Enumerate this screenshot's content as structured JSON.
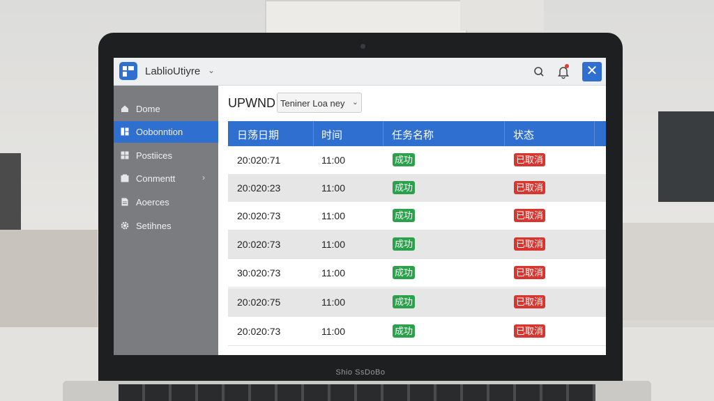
{
  "app": {
    "title": "LablioUtiyre",
    "brand_text": "Shio SsDoBo"
  },
  "colors": {
    "accent": "#2f6fd0",
    "success": "#2aa14a",
    "danger": "#d8352e",
    "sidebar": "#7b7c7f"
  },
  "sidebar": {
    "items": [
      {
        "label": "Dome",
        "icon": "home-icon"
      },
      {
        "label": "Oobonntion",
        "icon": "grid-icon",
        "active": true
      },
      {
        "label": "Postiices",
        "icon": "tiles-icon"
      },
      {
        "label": "Conmentt",
        "icon": "box-icon",
        "has_arrow": true
      },
      {
        "label": "Aoerces",
        "icon": "document-icon"
      },
      {
        "label": "Setihnes",
        "icon": "gear-icon"
      }
    ]
  },
  "main": {
    "title": "UPWND",
    "filter_value": "Teniner Loa ney",
    "table": {
      "headers": [
        "日荡日期",
        "时间",
        "任务名称",
        "状态"
      ],
      "rows": [
        {
          "date": "20:020:71",
          "time": "11:00",
          "task": "成功",
          "status": "已取消"
        },
        {
          "date": "20:020:23",
          "time": "11:00",
          "task": "成功",
          "status": "已取消"
        },
        {
          "date": "20:020:73",
          "time": "11:00",
          "task": "成功",
          "status": "已取消"
        },
        {
          "date": "20:020:73",
          "time": "11:00",
          "task": "成功",
          "status": "已取消"
        },
        {
          "date": "30:020:73",
          "time": "11:00",
          "task": "成功",
          "status": "已取消"
        },
        {
          "date": "20:020:75",
          "time": "11:00",
          "task": "成功",
          "status": "已取消"
        },
        {
          "date": "20:020:73",
          "time": "11:00",
          "task": "成功",
          "status": "已取消"
        }
      ]
    }
  }
}
